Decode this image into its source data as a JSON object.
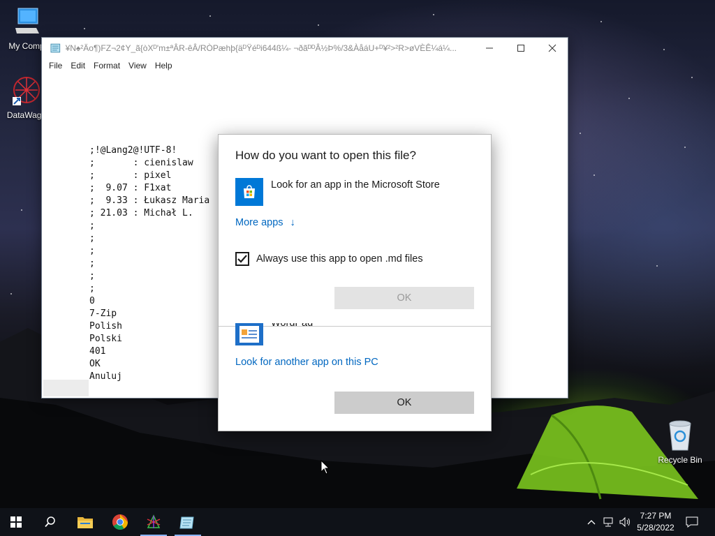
{
  "desktop": {
    "icons": [
      {
        "label": "My Comp",
        "icon": "computer-icon"
      },
      {
        "label": "DataWago",
        "icon": "datawagon-icon"
      },
      {
        "label": "Recycle Bin",
        "icon": "recycle-bin-icon"
      }
    ]
  },
  "notepad": {
    "title": "¥N♠²Äo¶)FZ¬2¢Y_ã{òXᴰ'm±ªÂR-êÂ/RÒPæhþ{äᴰŸéᴰi644ß¼- ¬ðãᴰᴰÂ½Þ%/3&ÀåáU+ᴰ¥²>²R>øVÈÊ¼á¼...",
    "menu": [
      "File",
      "Edit",
      "Format",
      "View",
      "Help"
    ],
    "content_lines": [
      ";!@Lang2@!UTF-8!",
      ";       : cienislaw",
      ";       : pixel",
      ";  9.07 : F1xat",
      ";  9.33 : Łukasz Maria",
      "; 21.03 : Michał L.",
      ";",
      ";",
      ";",
      ";",
      ";",
      ";",
      "0",
      "7-Zip",
      "Polish",
      "Polski",
      "401",
      "OK",
      "Anuluj"
    ]
  },
  "dialog": {
    "heading": "How do you want to open this file?",
    "store_option": "Look for an app in the Microsoft Store",
    "more_apps": "More apps",
    "more_apps_arrow": "↓",
    "always_use": "Always use this app to open .md files",
    "always_use_checked": true,
    "ok_disabled": "OK",
    "wordpad_label": "WordPad",
    "another_app": "Look for another app on this PC",
    "ok": "OK"
  },
  "taskbar": {
    "pinned": [
      "search-icon",
      "file-explorer-icon",
      "chrome-icon",
      "datawagon-icon",
      "notepad-icon"
    ],
    "time": "7:27 PM",
    "date": "5/28/2022"
  },
  "colors": {
    "accent": "#0078d7",
    "link": "#0067c0",
    "button": "#cccccc",
    "button_disabled": "#e3e3e3"
  }
}
